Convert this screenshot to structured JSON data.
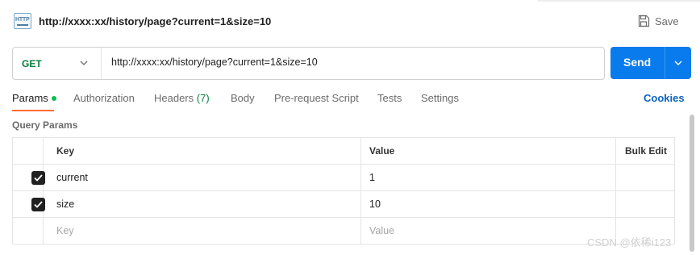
{
  "title_bar": {
    "icon": "http-request-icon",
    "icon_text": "HTTP",
    "request_name": "http://xxxx:xx/history/page?current=1&size=10",
    "save_label": "Save",
    "save_icon": "save-icon"
  },
  "request": {
    "method": "GET",
    "method_color": "#0a7d3e",
    "url": "http://xxxx:xx/history/page?current=1&size=10",
    "send_label": "Send",
    "send_color": "#097bed"
  },
  "tabs": [
    {
      "label": "Params",
      "active": true,
      "indicator": "green-dot"
    },
    {
      "label": "Authorization"
    },
    {
      "label": "Headers",
      "count": "(7)"
    },
    {
      "label": "Body"
    },
    {
      "label": "Pre-request Script"
    },
    {
      "label": "Tests"
    },
    {
      "label": "Settings"
    }
  ],
  "cookies_label": "Cookies",
  "query_params": {
    "section_label": "Query Params",
    "headers": {
      "key": "Key",
      "value": "Value",
      "bulk_edit": "Bulk Edit"
    },
    "rows": [
      {
        "checked": true,
        "key": "current",
        "value": "1"
      },
      {
        "checked": true,
        "key": "size",
        "value": "10"
      }
    ],
    "new_row": {
      "key_placeholder": "Key",
      "value_placeholder": "Value"
    }
  },
  "watermark": "CSDN @依稀i123",
  "colors": {
    "accent": "#ff6c37",
    "link": "#0b63c3"
  }
}
